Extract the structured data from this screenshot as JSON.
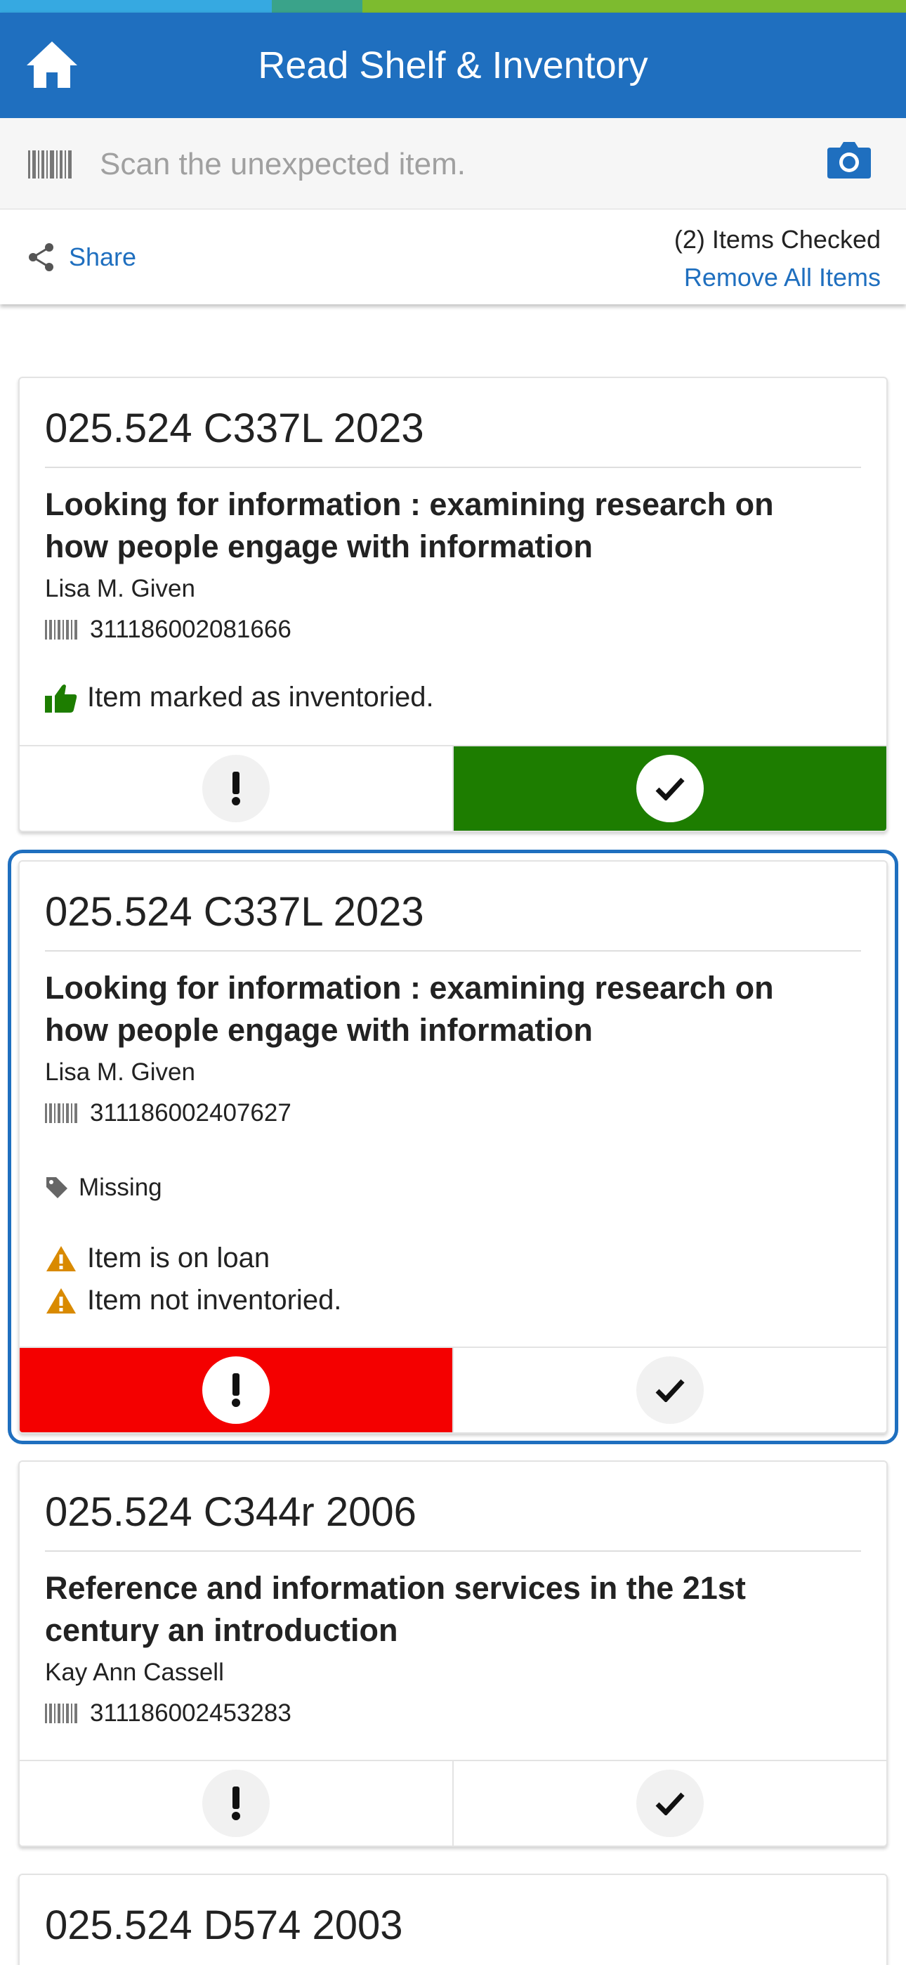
{
  "header": {
    "title": "Read Shelf & Inventory",
    "home_icon": "home-icon",
    "color": "#1f6fbf"
  },
  "scan": {
    "placeholder": "Scan the unexpected item.",
    "barcode_icon": "barcode-icon",
    "camera_icon": "camera-icon"
  },
  "actions": {
    "share_label": "Share",
    "items_checked": "(2) Items Checked",
    "remove_all": "Remove All Items"
  },
  "items": [
    {
      "call_number": "025.524 C337L 2023",
      "title": "Looking for information : examining research on how people engage with information",
      "author": "Lisa M. Given",
      "barcode": "311186002081666",
      "status": "Item marked as inventoried.",
      "state": "inventoried"
    },
    {
      "call_number": "025.524 C337L 2023",
      "title": "Looking for information : examining research on how people engage with information",
      "author": "Lisa M. Given",
      "barcode": "311186002407627",
      "tag": "Missing",
      "warnings": [
        "Item is on loan",
        "Item not inventoried."
      ],
      "state": "flagged"
    },
    {
      "call_number": "025.524 C344r 2006",
      "title": "Reference and information services in the 21st century an introduction",
      "author": "Kay Ann Cassell",
      "barcode": "311186002453283",
      "state": "unchecked"
    },
    {
      "call_number": "025.524 D574 2003"
    }
  ],
  "colors": {
    "accent": "#1f6fbf",
    "inventoried": "#1d7d00",
    "flagged": "#f40000",
    "warning": "#d98a00"
  }
}
